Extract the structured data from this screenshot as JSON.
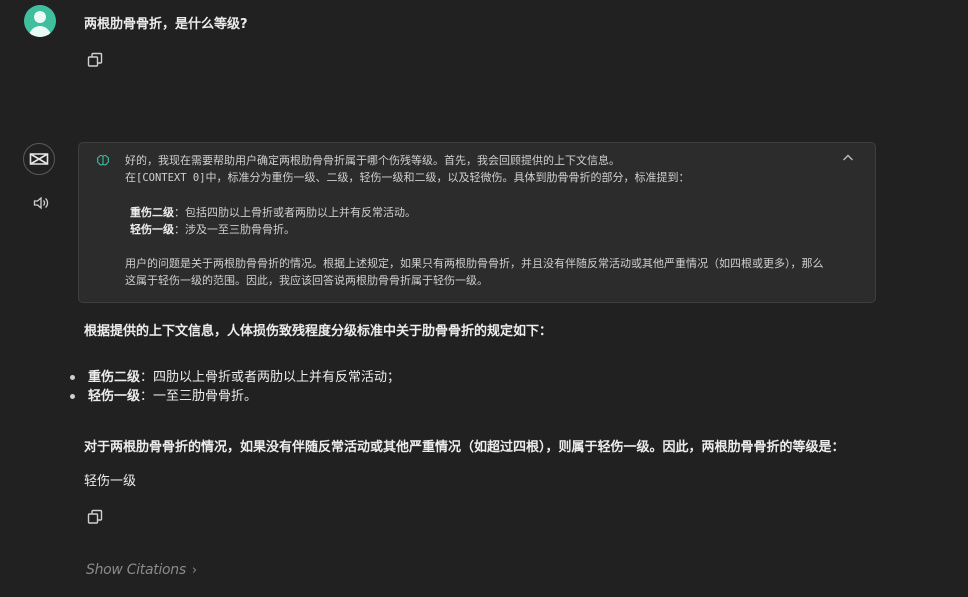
{
  "user_message": {
    "text": "两根肋骨骨折，是什么等级?",
    "avatar_icon": "user-avatar-icon",
    "copy_icon": "copy-icon"
  },
  "thinking": {
    "icon": "brain-icon",
    "line1": "好的，我现在需要帮助用户确定两根肋骨骨折属于哪个伤残等级。首先，我会回顾提供的上下文信息。",
    "line2_prefix": "在",
    "line2_code": "[CONTEXT 0]",
    "line2_suffix": "中，标准分为重伤一级、二级，轻伤一级和二级，以及轻微伤。具体到肋骨骨折的部分，标准提到：",
    "item1_term": "重伤二级",
    "item1_text": "：包括四肋以上骨折或者两肋以上并有反常活动。",
    "item2_term": "轻伤一级",
    "item2_text": "：涉及一至三肋骨骨折。",
    "conclusion": "用户的问题是关于两根肋骨骨折的情况。根据上述规定，如果只有两根肋骨骨折，并且没有伴随反常活动或其他严重情况（如四根或更多），那么这属于轻伤一级的范围。因此，我应该回答说两根肋骨骨折属于轻伤一级。"
  },
  "answer": {
    "intro": "根据提供的上下文信息，人体损伤致残程度分级标准中关于肋骨骨折的规定如下：",
    "bullets": [
      {
        "term": "重伤二级",
        "text": "：四肋以上骨折或者两肋以上并有反常活动；"
      },
      {
        "term": "轻伤一级",
        "text": "：一至三肋骨骨折。"
      }
    ],
    "para_before": "对于两根肋骨骨折的情况，如果没有伴随反常活动或其他严重情况（如超过四根），则属于",
    "para_bold": "轻伤一级",
    "para_after": "。因此，两根肋骨骨折的等级是：",
    "final": "轻伤一级"
  },
  "citations_label": "Show Citations",
  "colors": {
    "background": "#212121",
    "avatar": "#3fbf9e",
    "think_box": "#2c2c2c"
  }
}
